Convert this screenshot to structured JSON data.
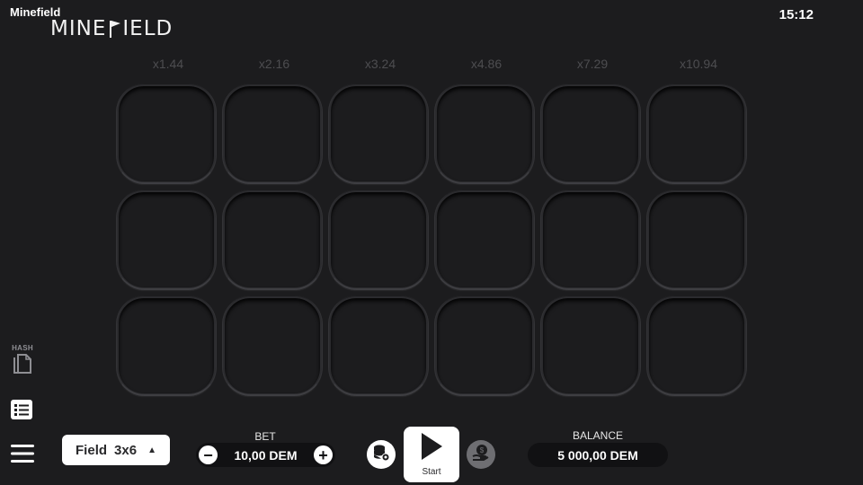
{
  "app": {
    "title": "Minefield",
    "clock": "15:12"
  },
  "logo": {
    "text_before": "MINE",
    "text_after": "IELD"
  },
  "multipliers": [
    "x1.44",
    "x2.16",
    "x3.24",
    "x4.86",
    "x7.29",
    "x10.94"
  ],
  "grid": {
    "rows": 3,
    "columns": 6
  },
  "sidebar": {
    "hash_label": "HASH",
    "hash_icon": "copy-document-icon",
    "history_icon": "list-icon",
    "menu_icon": "hamburger-menu-icon"
  },
  "field_selector": {
    "label": "Field",
    "value": "3x6"
  },
  "bet": {
    "label": "BET",
    "value": "10,00 DEM",
    "decrease": "−",
    "increase": "+"
  },
  "start": {
    "label": "Start"
  },
  "balance": {
    "label": "BALANCE",
    "value": "5 000,00 DEM"
  },
  "colors": {
    "background": "#1c1c1e",
    "multiplier_text": "#4d4d50",
    "button": "#ffffff",
    "field": "#111113"
  }
}
